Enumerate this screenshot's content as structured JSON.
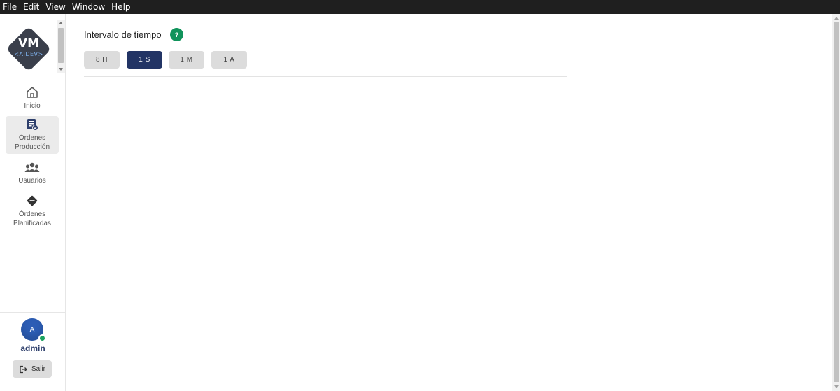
{
  "menubar": {
    "items": [
      "File",
      "Edit",
      "View",
      "Window",
      "Help"
    ]
  },
  "sidebar": {
    "logo_text_top": "VM",
    "logo_text_bottom": "<AIDEV>",
    "items": [
      {
        "label": "Inicio",
        "icon": "home-icon"
      },
      {
        "label_line1": "Órdenes",
        "label_line2": "Producción",
        "icon": "clipboard-check-icon",
        "active": true
      },
      {
        "label": "Usuarios",
        "icon": "users-icon"
      },
      {
        "label_line1": "Órdenes",
        "label_line2": "Planificadas",
        "icon": "diamond-minus-icon"
      }
    ],
    "user": {
      "avatar_initial": "A",
      "name": "admin",
      "status_color": "#1aa15f"
    },
    "logout_label": "Salir"
  },
  "main": {
    "title": "Intervalo de tiempo",
    "help_label": "?",
    "intervals": [
      {
        "label": "8 H",
        "active": false
      },
      {
        "label": "1 S",
        "active": true
      },
      {
        "label": "1 M",
        "active": false
      },
      {
        "label": "1 A",
        "active": false
      }
    ]
  },
  "colors": {
    "accent": "#223465",
    "help": "#10935b",
    "menubar": "#1f1f1f"
  }
}
